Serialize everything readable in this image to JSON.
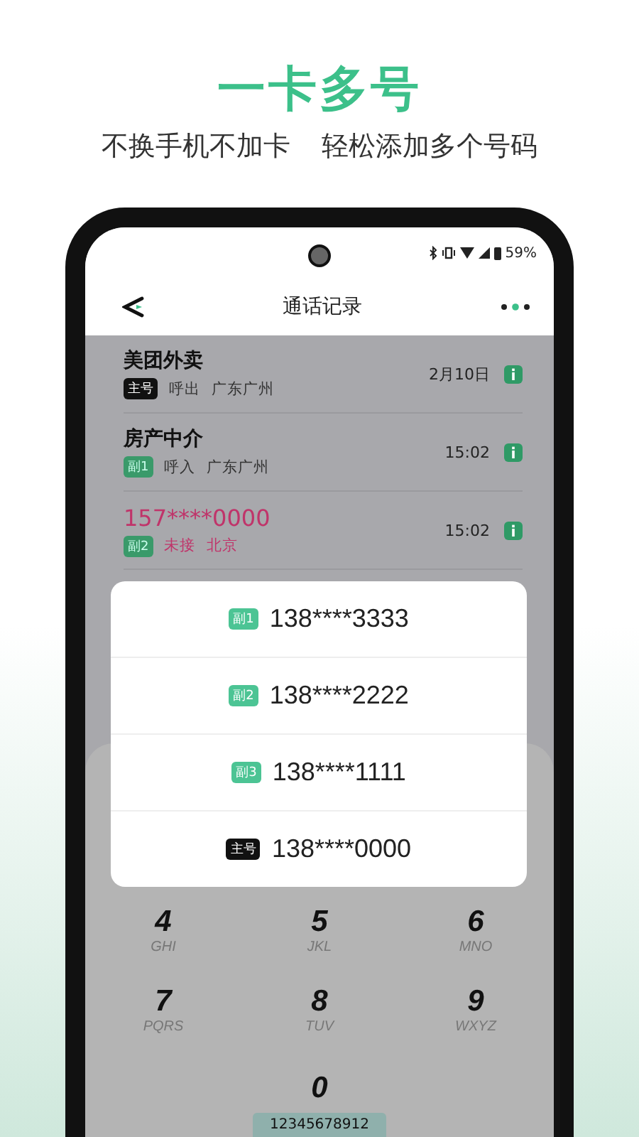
{
  "headline": "一卡多号",
  "subtitle": [
    "不换手机不加卡",
    "轻松添加多个号码"
  ],
  "status_bar": {
    "battery": "59%"
  },
  "header": {
    "title": "通话记录"
  },
  "calls": [
    {
      "name": "美团外卖",
      "tag": {
        "label": "主号",
        "kind": "main"
      },
      "direction": "呼出",
      "location": "广东广州",
      "time": "2月10日",
      "missed": false
    },
    {
      "name": "房产中介",
      "tag": {
        "label": "副1",
        "kind": "sub"
      },
      "direction": "呼入",
      "location": "广东广州",
      "time": "15:02",
      "missed": false
    },
    {
      "name": "157****0000",
      "tag": {
        "label": "副2",
        "kind": "sub"
      },
      "direction": "未接",
      "location": "北京",
      "time": "15:02",
      "missed": true
    }
  ],
  "number_picker": [
    {
      "tag": {
        "label": "副1",
        "kind": "sub"
      },
      "number": "138****3333"
    },
    {
      "tag": {
        "label": "副2",
        "kind": "sub"
      },
      "number": "138****2222"
    },
    {
      "tag": {
        "label": "副3",
        "kind": "sub"
      },
      "number": "138****1111"
    },
    {
      "tag": {
        "label": "主号",
        "kind": "main"
      },
      "number": "138****0000"
    }
  ],
  "keypad": [
    {
      "digit": "4",
      "letters": "GHI"
    },
    {
      "digit": "5",
      "letters": "JKL"
    },
    {
      "digit": "6",
      "letters": "MNO"
    },
    {
      "digit": "7",
      "letters": "PQRS"
    },
    {
      "digit": "8",
      "letters": "TUV"
    },
    {
      "digit": "9",
      "letters": "WXYZ"
    },
    {
      "digit": "0"
    }
  ],
  "dialed_number": "12345678912"
}
